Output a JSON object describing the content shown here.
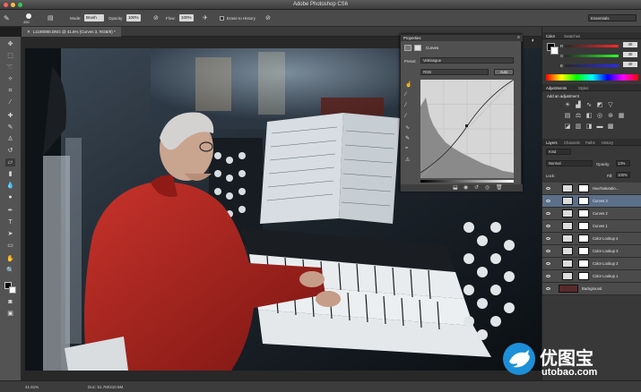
{
  "window": {
    "title": "Adobe Photoshop CS6"
  },
  "options_bar": {
    "brush_size": "450",
    "mode_label": "Mode:",
    "mode_value": "Brush",
    "opacity_label": "Opacity:",
    "opacity_value": "100%",
    "flow_label": "Flow:",
    "flow_value": "100%",
    "erase_history_label": "Erase to History",
    "workspace": "Essentials"
  },
  "document": {
    "tab_label": "L1190080.DNG @ 41.6% (Curves 3, RGB/8) *"
  },
  "status_bar": {
    "zoom": "41.61%",
    "doc_info": "Doc: 51.7M/410.5M"
  },
  "properties": {
    "tabs": [
      "Properties"
    ],
    "panel_title": "Curves",
    "preset_label": "Preset:",
    "preset_value": "Vetriangue",
    "channel_value": "RGB",
    "auto_label": "Auto"
  },
  "color_panel": {
    "tabs": [
      "Color",
      "Swatches"
    ],
    "r": "40",
    "g": "40",
    "b": "40",
    "labels": [
      "R",
      "G",
      "B"
    ]
  },
  "adjustments_panel": {
    "tabs": [
      "Adjustments",
      "Styles"
    ],
    "hint": "Add an adjustment"
  },
  "layers_panel": {
    "tabs": [
      "Layers",
      "Channels",
      "Paths",
      "History"
    ],
    "filter_value": "Kind",
    "blend_mode": "Normal",
    "opacity_label": "Opacity:",
    "opacity_value": "13%",
    "lock_label": "Lock:",
    "fill_label": "Fill:",
    "fill_value": "100%",
    "layers": [
      {
        "name": "Hue/Saturatio...",
        "selected": false
      },
      {
        "name": "Curves 3",
        "selected": true
      },
      {
        "name": "Curves 2",
        "selected": false
      },
      {
        "name": "Curves 1",
        "selected": false
      },
      {
        "name": "Color Lookup 4",
        "selected": false
      },
      {
        "name": "Color Lookup 3",
        "selected": false
      },
      {
        "name": "Color Lookup 2",
        "selected": false
      },
      {
        "name": "Color Lookup 1",
        "selected": false
      },
      {
        "name": "Background",
        "selected": false
      }
    ]
  },
  "watermark": {
    "brand": "优图宝",
    "url": "utobao.com"
  },
  "colors": {
    "accent": "#5b6f8a",
    "panel": "#383838",
    "shirt": "#b3231e",
    "watermark_blue": "#1d8fd8"
  }
}
